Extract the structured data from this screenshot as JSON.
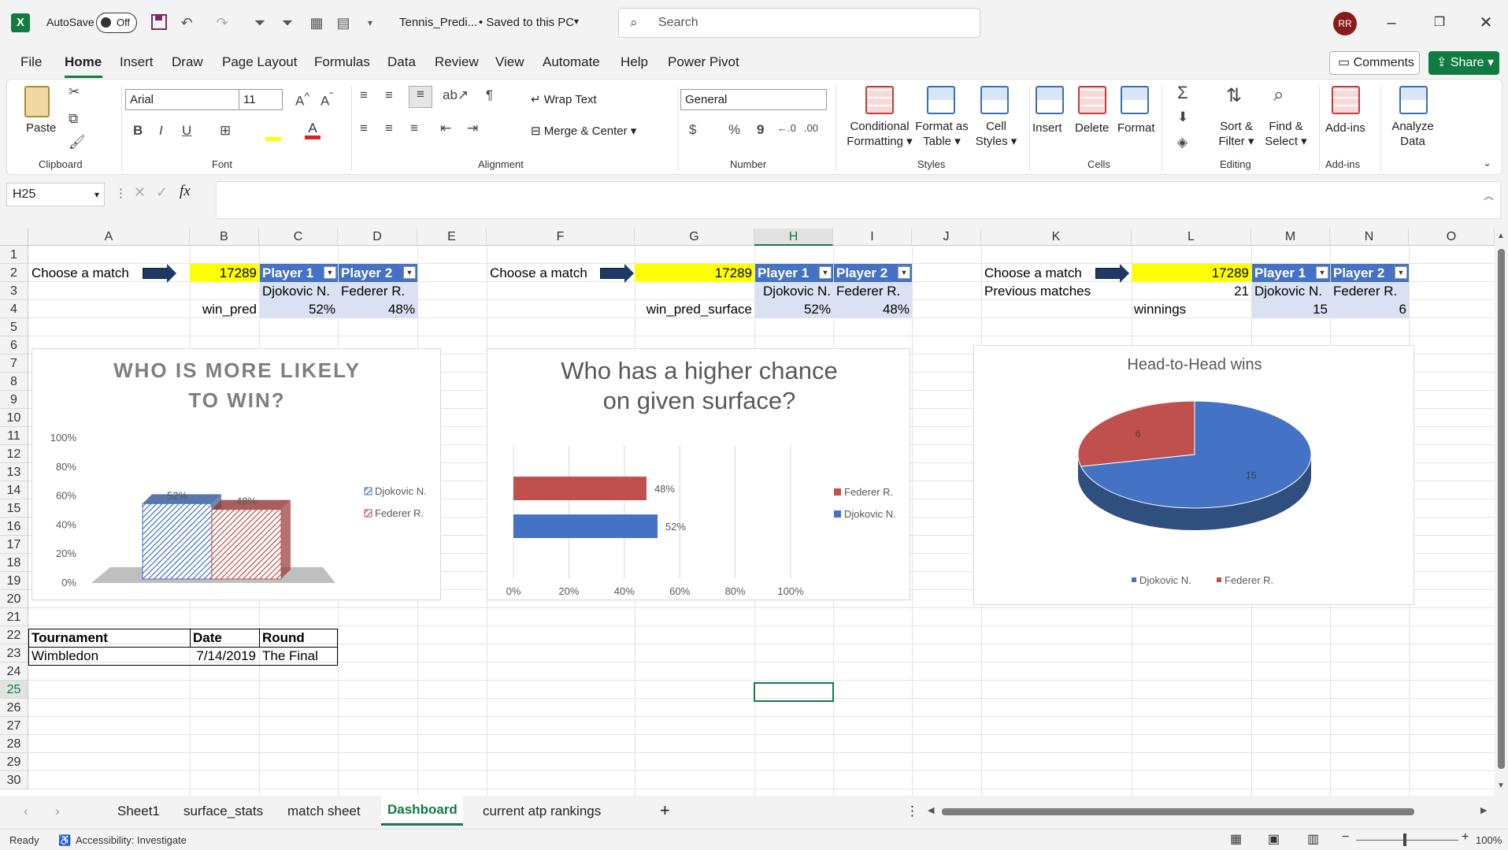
{
  "titlebar": {
    "autosave_label": "AutoSave",
    "autosave_state": "Off",
    "filename": "Tennis_Predi...",
    "saved_status": "• Saved to this PC",
    "search_placeholder": "Search",
    "user_initials": "RR"
  },
  "menu": {
    "items": [
      "File",
      "Home",
      "Insert",
      "Draw",
      "Page Layout",
      "Formulas",
      "Data",
      "Review",
      "View",
      "Automate",
      "Help",
      "Power Pivot"
    ],
    "active": "Home",
    "comments": "Comments",
    "share": "Share"
  },
  "ribbon": {
    "clipboard": {
      "paste": "Paste",
      "group": "Clipboard"
    },
    "font": {
      "name": "Arial",
      "size": "11",
      "group": "Font",
      "bold": "B",
      "italic": "I",
      "underline": "U"
    },
    "alignment": {
      "wrap": "Wrap Text",
      "merge": "Merge & Center",
      "group": "Alignment"
    },
    "number": {
      "format": "General",
      "group": "Number",
      "currency": "$",
      "percent": "%",
      "comma": "9"
    },
    "styles": {
      "cond1": "Conditional",
      "cond2": "Formatting",
      "fmt1": "Format as",
      "fmt2": "Table",
      "cell1": "Cell",
      "cell2": "Styles",
      "group": "Styles"
    },
    "cells": {
      "insert": "Insert",
      "delete": "Delete",
      "format": "Format",
      "group": "Cells"
    },
    "editing": {
      "sort1": "Sort &",
      "sort2": "Filter",
      "find1": "Find &",
      "find2": "Select",
      "group": "Editing"
    },
    "addins": {
      "label": "Add-ins",
      "group": "Add-ins"
    },
    "analyze": {
      "l1": "Analyze",
      "l2": "Data"
    }
  },
  "formula_bar": {
    "name_box": "H25",
    "fx": "fx",
    "formula": ""
  },
  "columns": [
    "A",
    "B",
    "C",
    "D",
    "E",
    "F",
    "G",
    "H",
    "I",
    "J",
    "K",
    "L",
    "M",
    "N",
    "O"
  ],
  "rows": [
    "1",
    "2",
    "3",
    "4",
    "5",
    "6",
    "7",
    "8",
    "9",
    "10",
    "11",
    "12",
    "13",
    "14",
    "15",
    "16",
    "17",
    "18",
    "19",
    "20",
    "21",
    "22",
    "23",
    "24",
    "25",
    "26",
    "27",
    "28",
    "29",
    "30"
  ],
  "cells": {
    "a2": "Choose a match",
    "b2": "17289",
    "c2": "Player 1",
    "d2": "Player 2",
    "c3": "Djokovic N.",
    "d3": "Federer R.",
    "b4": "win_pred",
    "c4": "52%",
    "d4": "48%",
    "f2": "Choose a match",
    "g2": "17289",
    "h2": "Player 1",
    "i2": "Player 2",
    "h3": "Djokovic N.",
    "i3": "Federer R.",
    "g4": "win_pred_surface",
    "h4": "52%",
    "i4": "48%",
    "k2": "Choose a match",
    "l2": "17289",
    "m2": "Player 1",
    "n2": "Player 2",
    "k3": "Previous matches",
    "l3": "21",
    "m3": "Djokovic N.",
    "n3": "Federer R.",
    "l4": "winnings",
    "m4": "15",
    "n4": "6",
    "a22": "Tournament",
    "b22": "Date",
    "c22": "Round",
    "a23": "Wimbledon",
    "b23": "7/14/2019",
    "c23": "The Final"
  },
  "chart_data": [
    {
      "type": "bar",
      "title": "WHO IS MORE LIKELY TO WIN?",
      "categories": [
        ""
      ],
      "series": [
        {
          "name": "Djokovic N.",
          "values": [
            52
          ]
        },
        {
          "name": "Federer R.",
          "values": [
            48
          ]
        }
      ],
      "data_labels": [
        "52%",
        "48%"
      ],
      "yticks": [
        "100%",
        "80%",
        "60%",
        "40%",
        "20%",
        "0%"
      ],
      "ylim": [
        0,
        100
      ],
      "style": "3d-column",
      "legend": "right",
      "colors": [
        "#4472c4",
        "#c0504d"
      ]
    },
    {
      "type": "bar",
      "title": "Who has a higher chance on given surface?",
      "orientation": "horizontal",
      "series": [
        {
          "name": "Federer R.",
          "values": [
            48
          ]
        },
        {
          "name": "Djokovic N.",
          "values": [
            52
          ]
        }
      ],
      "data_labels": [
        "48%",
        "52%"
      ],
      "xticks": [
        "0%",
        "20%",
        "40%",
        "60%",
        "80%",
        "100%"
      ],
      "xlim": [
        0,
        100
      ],
      "legend": "right",
      "grid": true,
      "colors": [
        "#c0504d",
        "#4472c4"
      ]
    },
    {
      "type": "pie",
      "title": "Head-to-Head wins",
      "labels": [
        "Djokovic N.",
        "Federer R."
      ],
      "values": [
        15,
        6
      ],
      "style": "3d-pie",
      "legend": "bottom",
      "colors": [
        "#4472c4",
        "#c0504d"
      ]
    }
  ],
  "sheet_tabs": [
    "Sheet1",
    "surface_stats",
    "match sheet",
    "Dashboard",
    "current atp rankings"
  ],
  "active_tab": "Dashboard",
  "status": {
    "ready": "Ready",
    "accessibility": "Accessibility: Investigate",
    "zoom": "100%"
  }
}
